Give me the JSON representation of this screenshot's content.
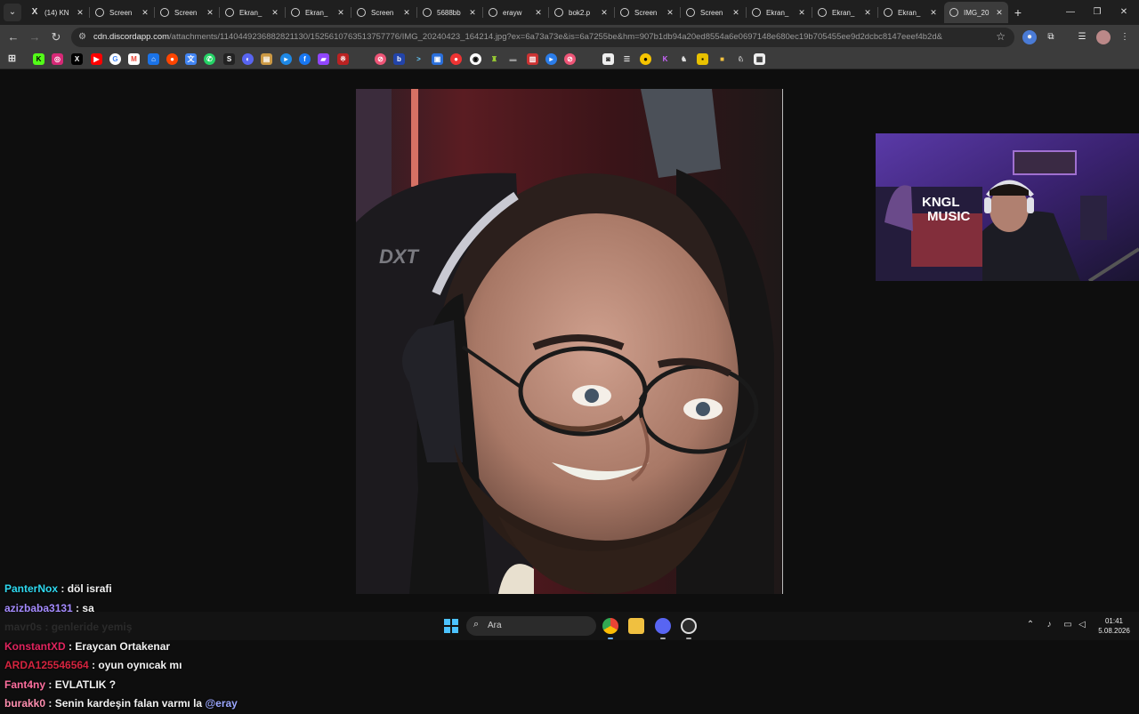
{
  "tabs": [
    {
      "label": "(14) KN",
      "icon": "x-logo"
    },
    {
      "label": "Screen",
      "icon": "globe"
    },
    {
      "label": "Screen",
      "icon": "globe"
    },
    {
      "label": "Ekran_",
      "icon": "globe"
    },
    {
      "label": "Ekran_",
      "icon": "globe"
    },
    {
      "label": "Screen",
      "icon": "globe"
    },
    {
      "label": "5688bb",
      "icon": "globe"
    },
    {
      "label": "erayw",
      "icon": "globe"
    },
    {
      "label": "bok2.p",
      "icon": "globe"
    },
    {
      "label": "Screen",
      "icon": "globe"
    },
    {
      "label": "Screen",
      "icon": "globe"
    },
    {
      "label": "Ekran_",
      "icon": "globe"
    },
    {
      "label": "Ekran_",
      "icon": "globe"
    },
    {
      "label": "Ekran_",
      "icon": "globe"
    },
    {
      "label": "IMG_20",
      "icon": "globe",
      "active": true
    }
  ],
  "address": {
    "domain": "cdn.discordapp.com",
    "path": "/attachments/1140449236882821130/1525610763513757776/IMG_20240423_164214.jpg?ex=6a73a73e&is=6a7255be&hm=907b1db94a20ed8554a6e0697148e680ec19b705455ee9d2dcbc8147eeef4b2d&"
  },
  "chat": [
    {
      "user": "PanterNox",
      "color": "#2ed9f0",
      "text": "döl israfi"
    },
    {
      "user": "azizbaba3131",
      "color": "#a58bff",
      "text": "sa"
    },
    {
      "user": "mavr0s",
      "color": "#f2f2f2",
      "text": "genleride yemiş"
    },
    {
      "user": "KonstantXD",
      "color": "#e0245e",
      "text": "Eraycan Ortakenar"
    },
    {
      "user": "ARDA125546564",
      "color": "#d4243f",
      "text": "oyun oynıcak mı"
    },
    {
      "user": "Fant4ny",
      "color": "#ff6f9f",
      "text": "EVLATLIK ?"
    },
    {
      "user": "burakk0",
      "color": "#ff8fb0",
      "text": "Senin kardeşin falan varmı la",
      "mention": "@eray"
    }
  ],
  "webcam": {
    "sign_line1": "KNGL",
    "sign_line2": "MUSIC"
  },
  "taskbar": {
    "search_placeholder": "Ara",
    "time": "01:41",
    "date": "5.08.2026"
  }
}
